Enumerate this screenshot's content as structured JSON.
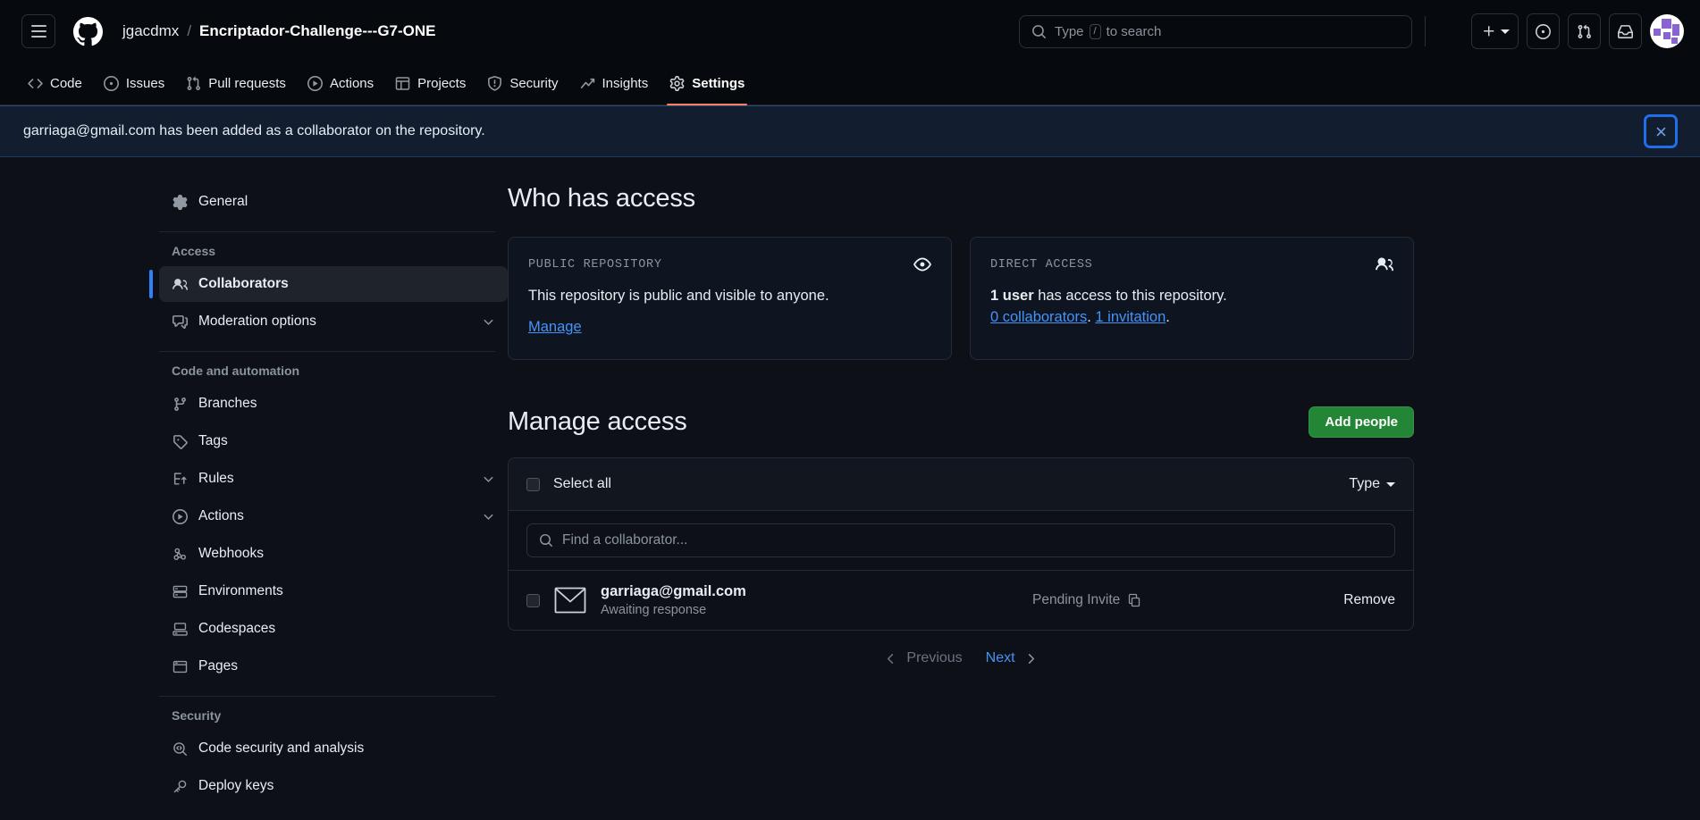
{
  "header": {
    "menu_icon": "hamburger-icon",
    "logo_icon": "github-logo-icon",
    "owner": "jgacdmx",
    "separator": "/",
    "repo": "Encriptador-Challenge---G7-ONE",
    "search": {
      "icon": "search-icon",
      "placeholder_prefix": "Type",
      "key_hint": "/",
      "placeholder_suffix": "to search"
    },
    "actions": [
      {
        "name": "create-new-button",
        "icon": "plus-icon"
      },
      {
        "name": "issues-button",
        "icon": "issue-opened-icon"
      },
      {
        "name": "pull-requests-button",
        "icon": "git-pull-request-icon"
      },
      {
        "name": "inbox-button",
        "icon": "inbox-icon"
      },
      {
        "name": "avatar-button",
        "icon": "avatar"
      }
    ]
  },
  "repo_nav": {
    "tabs": [
      {
        "label": "Code",
        "icon": "code-icon",
        "active": false
      },
      {
        "label": "Issues",
        "icon": "issue-opened-icon",
        "active": false
      },
      {
        "label": "Pull requests",
        "icon": "git-pull-request-icon",
        "active": false
      },
      {
        "label": "Actions",
        "icon": "play-icon",
        "active": false
      },
      {
        "label": "Projects",
        "icon": "table-icon",
        "active": false
      },
      {
        "label": "Security",
        "icon": "shield-icon",
        "active": false
      },
      {
        "label": "Insights",
        "icon": "graph-icon",
        "active": false
      },
      {
        "label": "Settings",
        "icon": "gear-icon",
        "active": true
      }
    ],
    "active_underline_color": "#f78166"
  },
  "flash": {
    "message": "garriaga@gmail.com has been added as a collaborator on the repository.",
    "close_icon": "close-icon",
    "background": "#121d2f",
    "focus_ring": "#1f6feb"
  },
  "sidebar": {
    "general": {
      "label": "General",
      "icon": "gear-icon"
    },
    "groups": [
      {
        "title": "Access",
        "items": [
          {
            "label": "Collaborators",
            "icon": "people-icon",
            "selected": true,
            "expandable": false
          },
          {
            "label": "Moderation options",
            "icon": "comment-discussion-icon",
            "selected": false,
            "expandable": true
          }
        ]
      },
      {
        "title": "Code and automation",
        "items": [
          {
            "label": "Branches",
            "icon": "git-branch-icon",
            "selected": false,
            "expandable": false
          },
          {
            "label": "Tags",
            "icon": "tag-icon",
            "selected": false,
            "expandable": false
          },
          {
            "label": "Rules",
            "icon": "rules-icon",
            "selected": false,
            "expandable": true
          },
          {
            "label": "Actions",
            "icon": "play-icon",
            "selected": false,
            "expandable": true
          },
          {
            "label": "Webhooks",
            "icon": "webhook-icon",
            "selected": false,
            "expandable": false
          },
          {
            "label": "Environments",
            "icon": "server-icon",
            "selected": false,
            "expandable": false
          },
          {
            "label": "Codespaces",
            "icon": "codespaces-icon",
            "selected": false,
            "expandable": false
          },
          {
            "label": "Pages",
            "icon": "browser-icon",
            "selected": false,
            "expandable": false
          }
        ]
      },
      {
        "title": "Security",
        "items": [
          {
            "label": "Code security and analysis",
            "icon": "code-scan-icon",
            "selected": false,
            "expandable": false
          },
          {
            "label": "Deploy keys",
            "icon": "key-icon",
            "selected": false,
            "expandable": false
          }
        ]
      }
    ],
    "selected_indicator_color": "#2f81f7"
  },
  "main": {
    "who_has_access_title": "Who has access",
    "cards": [
      {
        "kicker": "PUBLIC REPOSITORY",
        "icon": "eye-icon",
        "body": "This repository is public and visible to anyone.",
        "link": "Manage"
      },
      {
        "kicker": "DIRECT ACCESS",
        "icon": "people-icon",
        "body_strong": "1 user",
        "body_rest": " has access to this repository.",
        "link_collaborators": "0 collaborators",
        "link_separator": ". ",
        "link_invitation": "1 invitation",
        "trailing_period": "."
      }
    ],
    "manage_access_title": "Manage access",
    "add_people_button": "Add people",
    "add_people_color": "#238636",
    "panel": {
      "select_all_label": "Select all",
      "type_filter_label": "Type",
      "search_placeholder": "Find a collaborator...",
      "search_icon": "search-icon",
      "rows": [
        {
          "avatar_icon": "mail-icon",
          "email": "garriaga@gmail.com",
          "status": "Awaiting response",
          "badge": "Pending Invite",
          "badge_icon": "copy-icon",
          "action": "Remove"
        }
      ]
    },
    "pagination": {
      "previous_label": "Previous",
      "next_label": "Next",
      "prev_icon": "chevron-left-icon",
      "next_icon": "chevron-right-icon"
    }
  }
}
